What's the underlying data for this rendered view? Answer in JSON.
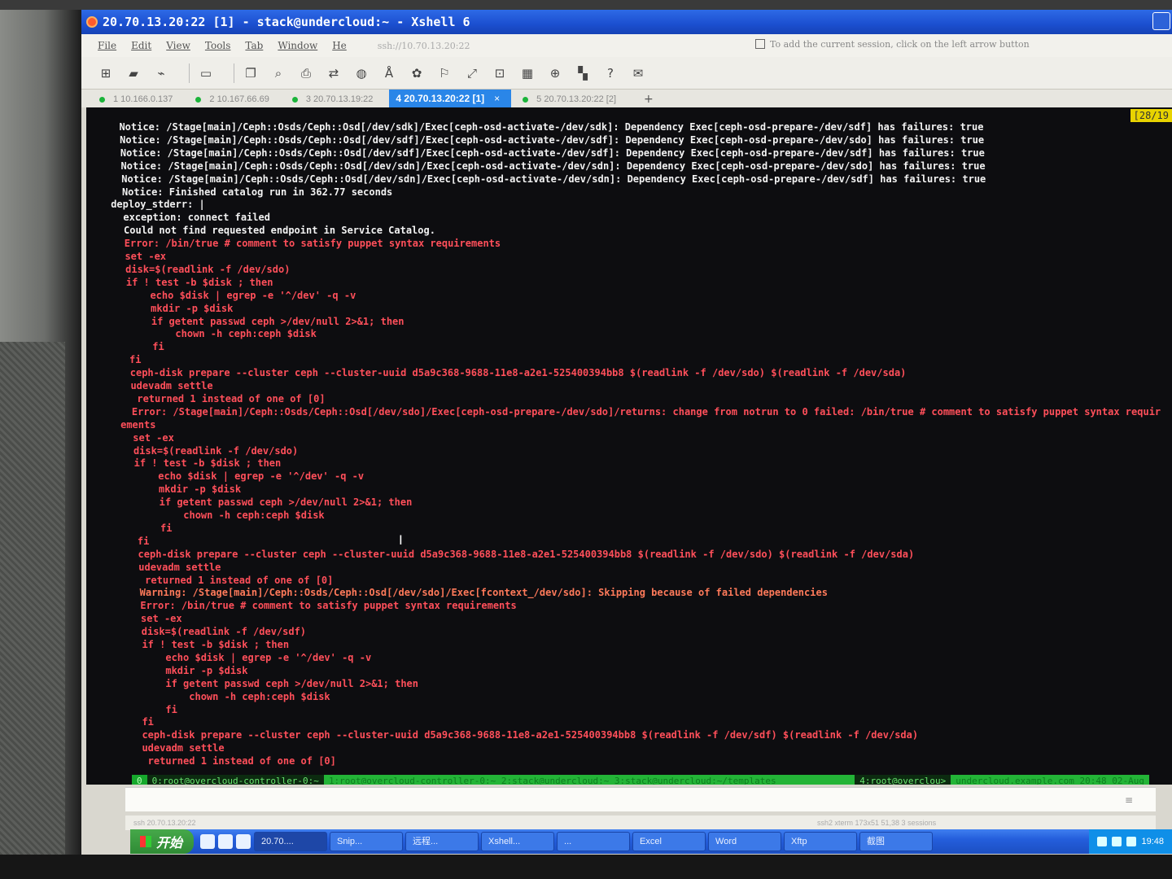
{
  "window": {
    "title": "20.70.13.20:22 [1] - stack@undercloud:~ - Xshell 6"
  },
  "menu": {
    "items": [
      "File",
      "Edit",
      "View",
      "Tools",
      "Tab",
      "Window",
      "He"
    ],
    "session": "ssh://10.70.13.20:22",
    "hint": "To add the current session, click on the left arrow button"
  },
  "tabs": [
    {
      "label": "1 10.166.0.137"
    },
    {
      "label": "2 10.167.66.69"
    },
    {
      "label": "3 20.70.13.19:22"
    },
    {
      "label": "4 20.70.13.20:22 [1]",
      "active": true
    },
    {
      "label": "5 20.70.13.20:22 [2]"
    }
  ],
  "tab_close": "×",
  "tab_add": "+",
  "terminal": {
    "counter": "[28/19",
    "lines": [
      {
        "text": "  Notice: /Stage[main]/Ceph::Osds/Ceph::Osd[/dev/sdk]/Exec[ceph-osd-activate-/dev/sdk]: Dependency Exec[ceph-osd-prepare-/dev/sdf] has failures: true",
        "c": "w"
      },
      {
        "text": "  Notice: /Stage[main]/Ceph::Osds/Ceph::Osd[/dev/sdf]/Exec[ceph-osd-activate-/dev/sdf]: Dependency Exec[ceph-osd-prepare-/dev/sdo] has failures: true",
        "c": "w"
      },
      {
        "text": "  Notice: /Stage[main]/Ceph::Osds/Ceph::Osd[/dev/sdf]/Exec[ceph-osd-activate-/dev/sdf]: Dependency Exec[ceph-osd-prepare-/dev/sdf] has failures: true",
        "c": "w"
      },
      {
        "text": "  Notice: /Stage[main]/Ceph::Osds/Ceph::Osd[/dev/sdn]/Exec[ceph-osd-activate-/dev/sdn]: Dependency Exec[ceph-osd-prepare-/dev/sdo] has failures: true",
        "c": "w"
      },
      {
        "text": "  Notice: /Stage[main]/Ceph::Osds/Ceph::Osd[/dev/sdn]/Exec[ceph-osd-activate-/dev/sdn]: Dependency Exec[ceph-osd-prepare-/dev/sdf] has failures: true",
        "c": "w"
      },
      {
        "text": "  Notice: Finished catalog run in 362.77 seconds",
        "c": "w"
      },
      {
        "text": "deploy_stderr: |",
        "c": "w"
      },
      {
        "text": "  exception: connect failed",
        "c": "w"
      },
      {
        "text": "  Could not find requested endpoint in Service Catalog.",
        "c": "w"
      },
      {
        "text": "  Error: /bin/true # comment to satisfy puppet syntax requirements",
        "c": "r"
      },
      {
        "text": "  set -ex",
        "c": "r"
      },
      {
        "text": "  disk=$(readlink -f /dev/sdo)",
        "c": "r"
      },
      {
        "text": "  if ! test -b $disk ; then",
        "c": "r"
      },
      {
        "text": "      echo $disk | egrep -e '^/dev' -q -v",
        "c": "r"
      },
      {
        "text": "      mkdir -p $disk",
        "c": "r"
      },
      {
        "text": "      if getent passwd ceph >/dev/null 2>&1; then",
        "c": "r"
      },
      {
        "text": "          chown -h ceph:ceph $disk",
        "c": "r"
      },
      {
        "text": "      fi",
        "c": "r"
      },
      {
        "text": "  fi",
        "c": "r"
      },
      {
        "text": "  ceph-disk prepare --cluster ceph --cluster-uuid d5a9c368-9688-11e8-a2e1-525400394bb8 $(readlink -f /dev/sdo) $(readlink -f /dev/sda)",
        "c": "r"
      },
      {
        "text": "  udevadm settle",
        "c": "r"
      },
      {
        "text": "   returned 1 instead of one of [0]",
        "c": "r"
      },
      {
        "text": "  Error: /Stage[main]/Ceph::Osds/Ceph::Osd[/dev/sdo]/Exec[ceph-osd-prepare-/dev/sdo]/returns: change from notrun to 0 failed: /bin/true # comment to satisfy puppet syntax requir",
        "c": "r"
      },
      {
        "text": "ements",
        "c": "r"
      },
      {
        "text": "  set -ex",
        "c": "r"
      },
      {
        "text": "  disk=$(readlink -f /dev/sdo)",
        "c": "r"
      },
      {
        "text": "  if ! test -b $disk ; then",
        "c": "r"
      },
      {
        "text": "      echo $disk | egrep -e '^/dev' -q -v",
        "c": "r"
      },
      {
        "text": "      mkdir -p $disk",
        "c": "r"
      },
      {
        "text": "      if getent passwd ceph >/dev/null 2>&1; then",
        "c": "r"
      },
      {
        "text": "          chown -h ceph:ceph $disk",
        "c": "r"
      },
      {
        "text": "      fi",
        "c": "r"
      },
      {
        "text": "  fi",
        "c": "r"
      },
      {
        "text": "  ceph-disk prepare --cluster ceph --cluster-uuid d5a9c368-9688-11e8-a2e1-525400394bb8 $(readlink -f /dev/sdo) $(readlink -f /dev/sda)",
        "c": "r"
      },
      {
        "text": "  udevadm settle",
        "c": "r"
      },
      {
        "text": "   returned 1 instead of one of [0]",
        "c": "r"
      },
      {
        "text": "  Warning: /Stage[main]/Ceph::Osds/Ceph::Osd[/dev/sdo]/Exec[fcontext_/dev/sdo]: Skipping because of failed dependencies",
        "c": "o"
      },
      {
        "text": "  Error: /bin/true # comment to satisfy puppet syntax requirements",
        "c": "r"
      },
      {
        "text": "  set -ex",
        "c": "r"
      },
      {
        "text": "  disk=$(readlink -f /dev/sdf)",
        "c": "r"
      },
      {
        "text": "  if ! test -b $disk ; then",
        "c": "r"
      },
      {
        "text": "      echo $disk | egrep -e '^/dev' -q -v",
        "c": "r"
      },
      {
        "text": "      mkdir -p $disk",
        "c": "r"
      },
      {
        "text": "      if getent passwd ceph >/dev/null 2>&1; then",
        "c": "r"
      },
      {
        "text": "          chown -h ceph:ceph $disk",
        "c": "r"
      },
      {
        "text": "      fi",
        "c": "r"
      },
      {
        "text": "  fi",
        "c": "r"
      },
      {
        "text": "  ceph-disk prepare --cluster ceph --cluster-uuid d5a9c368-9688-11e8-a2e1-525400394bb8 $(readlink -f /dev/sdf) $(readlink -f /dev/sda)",
        "c": "r"
      },
      {
        "text": "  udevadm settle",
        "c": "r"
      },
      {
        "text": "   returned 1 instead of one of [0]",
        "c": "r"
      }
    ]
  },
  "statusbar": {
    "num": "0",
    "active": "0:root@overcloud-controller-0:~",
    "dim": "1:root@overcloud-controller-0:~  2:stack@undercloud:~  3:stack@undercloud:~/templates",
    "right": "4:root@overclou>",
    "date": "undercloud.example.com  20:48 02-Aug"
  },
  "compose_menu": "≡",
  "ssh_status": {
    "left": "ssh   20.70.13.20:22",
    "right": "ssh2   xterm   173x51   51,38   3 sessions"
  },
  "taskbar": {
    "start": "开始",
    "tasks": [
      "20.70....",
      "Snip...",
      "远程...",
      "Xshell...",
      "...",
      "Excel",
      "Word",
      "Xftp",
      "截图"
    ],
    "clock": "19:48"
  }
}
